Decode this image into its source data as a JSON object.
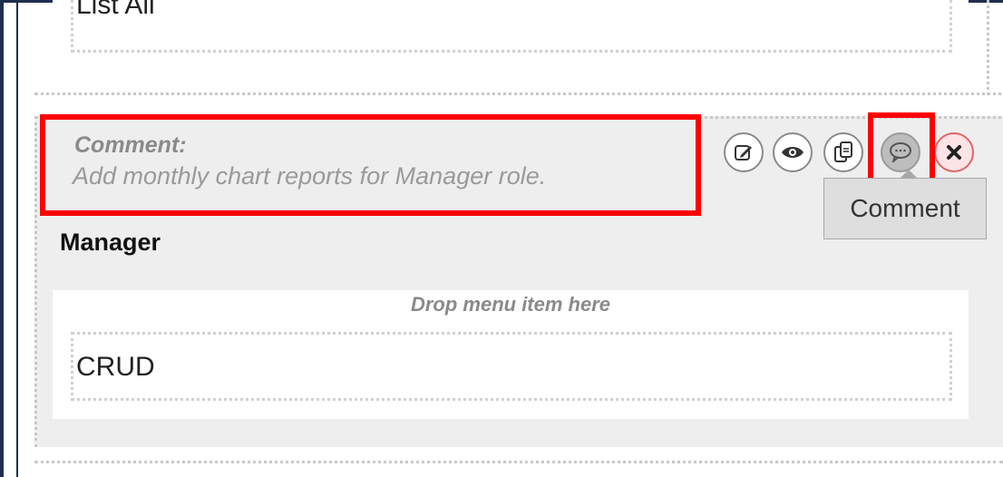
{
  "items": {
    "previous_item_label": "List All",
    "comment": {
      "label": "Comment:",
      "text": "Add monthly chart reports for Manager role."
    },
    "actions": {
      "edit_icon": "edit-icon",
      "view_icon": "eye-icon",
      "copy_icon": "copy-icon",
      "comment_icon": "comment-icon",
      "delete_icon": "close-icon",
      "tooltip": "Comment"
    },
    "role_name": "Manager",
    "drop_hint": "Drop menu item here",
    "menu_item_label": "CRUD"
  },
  "colors": {
    "highlight": "#ff0000",
    "frame": "#1e2f4e",
    "panel_bg": "#eeeeee"
  }
}
